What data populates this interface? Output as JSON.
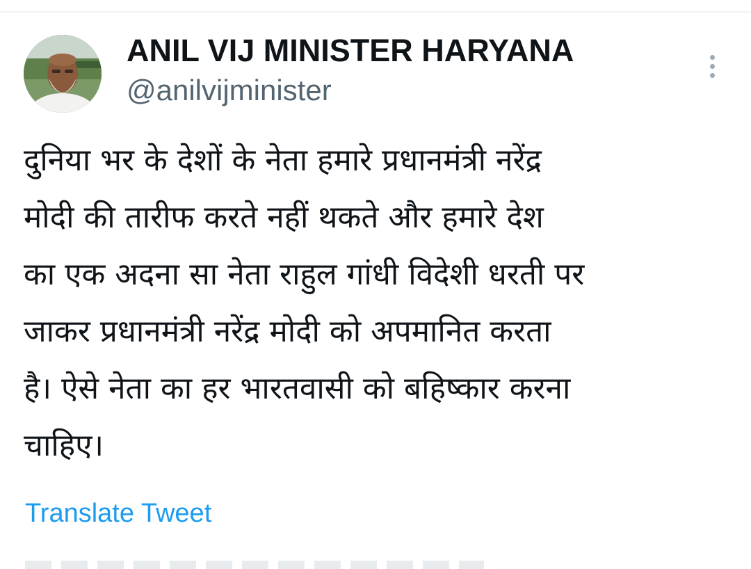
{
  "author": {
    "display_name": "ANIL VIJ MINISTER HARYANA",
    "handle": "@anilvijminister"
  },
  "tweet": {
    "text": "दुनिया भर के देशों के नेता हमारे प्रधानमंत्री नरेंद्र\nमोदी की तारीफ करते नहीं थकते और हमारे देश\nका एक अदना सा नेता राहुल गांधी विदेशी धरती पर\nजाकर प्रधानमंत्री नरेंद्र मोदी को अपमानित करता\nहै। ऐसे नेता का हर भारतवासी को बहिष्कार करना\nचाहिए।",
    "translate_label": "Translate Tweet"
  },
  "icons": {
    "more": "more-vertical-icon"
  },
  "colors": {
    "text_primary": "#0f1419",
    "text_secondary": "#536471",
    "link": "#1d9bf0"
  }
}
